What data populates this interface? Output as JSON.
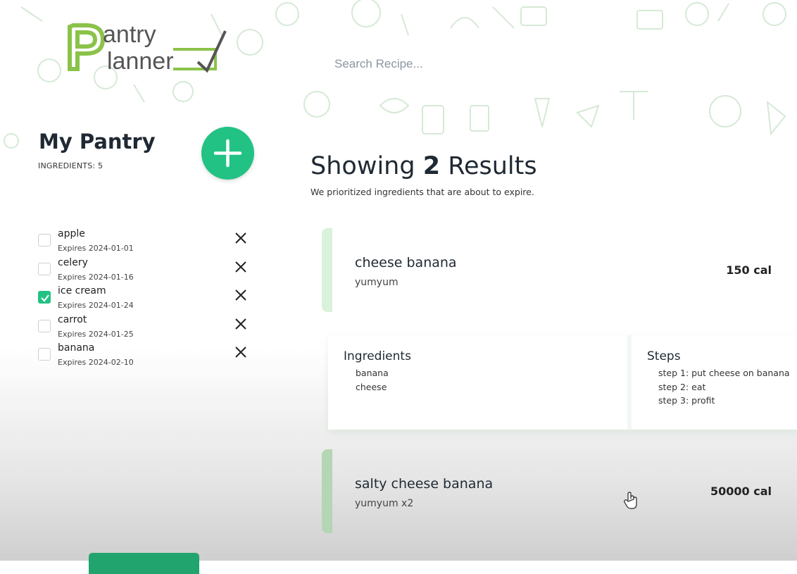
{
  "search": {
    "placeholder": "Search Recipe..."
  },
  "pantry": {
    "title": "My Pantry",
    "count_label": "INGREDIENTS: 5",
    "items": [
      {
        "name": "apple",
        "expires": "Expires 2024-01-01",
        "checked": false
      },
      {
        "name": "celery",
        "expires": "Expires 2024-01-16",
        "checked": false
      },
      {
        "name": "ice cream",
        "expires": "Expires 2024-01-24",
        "checked": true
      },
      {
        "name": "carrot",
        "expires": "Expires 2024-01-25",
        "checked": false
      },
      {
        "name": "banana",
        "expires": "Expires 2024-02-10",
        "checked": false
      }
    ]
  },
  "results": {
    "prefix": "Showing",
    "count": "2",
    "suffix": "Results",
    "subtitle": "We prioritized ingredients that are about to expire."
  },
  "recipes": [
    {
      "name": "cheese banana",
      "description": "yumyum",
      "calories": "150 cal",
      "ingredients_heading": "Ingredients",
      "ingredients": [
        "banana",
        "cheese"
      ],
      "steps_heading": "Steps",
      "steps": [
        "step 1: put cheese on banana",
        "step 2: eat",
        "step 3: profit"
      ]
    },
    {
      "name": "salty cheese banana",
      "description": "yumyum x2",
      "calories": "50000 cal"
    }
  ],
  "colors": {
    "accent": "#22c284",
    "bar_light": "#d9f2d9",
    "bar_dark": "#b4d6b4"
  }
}
